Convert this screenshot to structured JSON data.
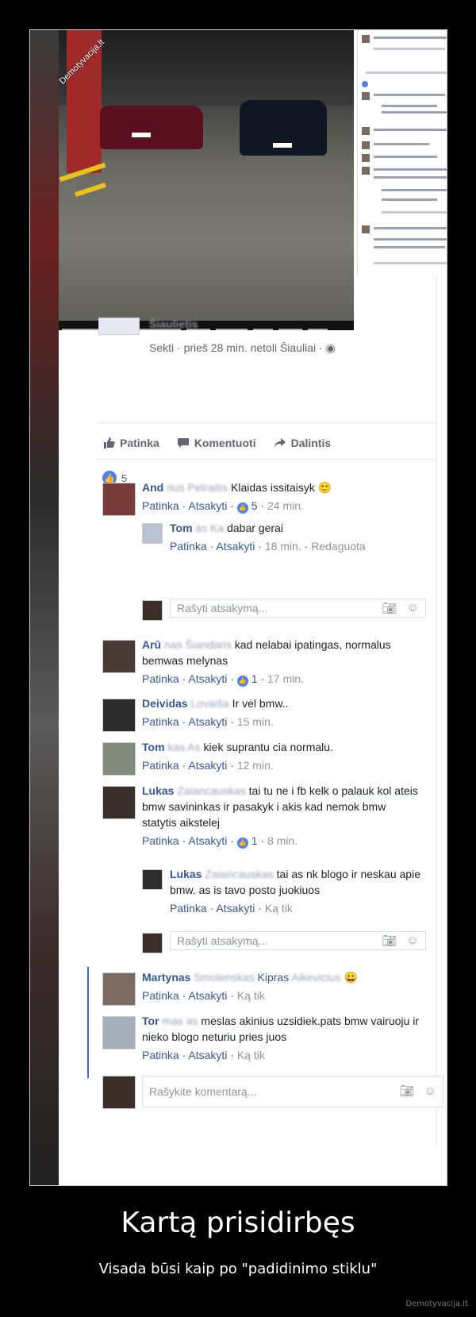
{
  "watermark": "Demotyvacija.lt",
  "post": {
    "author_blurred": "Šiaulietis",
    "meta": "Sekti · prieš 28 min. netoli Šiauliai · ",
    "actions": {
      "like": "Patinka",
      "comment": "Komentuoti",
      "share": "Dalintis"
    },
    "like_count": "5"
  },
  "comments": [
    {
      "name": "And",
      "name_blurred": "rius Petraitis",
      "text": "Klaidas issitaisyk 🙂",
      "like": "Patinka",
      "reply": "Atsakyti",
      "likes": "5",
      "time": "24 min."
    },
    {
      "name": "Tom",
      "name_blurred": "as Ka",
      "text": "dabar gerai",
      "like": "Patinka",
      "reply": "Atsakyti",
      "time": "18 min.",
      "edited": "Redaguota"
    },
    {
      "name": "Arū",
      "name_blurred": "nas Šiandaris",
      "text": "kad nelabai ipatingas, normalus bemwas melynas",
      "like": "Patinka",
      "reply": "Atsakyti",
      "likes": "1",
      "time": "17 min."
    },
    {
      "name": "Deividas",
      "name_blurred": "Lovaiša",
      "text": "Ir vėl bmw..",
      "like": "Patinka",
      "reply": "Atsakyti",
      "time": "15 min."
    },
    {
      "name": "Tom",
      "name_blurred": "kas As",
      "text": "kiek suprantu cia normalu.",
      "like": "Patinka",
      "reply": "Atsakyti",
      "time": "12 min."
    },
    {
      "name": "Lukas",
      "name_blurred": "Zaiancauskas",
      "text": "tai tu ne i fb kelk o palauk kol ateis bmw savininkas ir pasakyk i akis kad nemok bmw statytis aikstelej",
      "like": "Patinka",
      "reply": "Atsakyti",
      "likes": "1",
      "time": "8 min."
    },
    {
      "name": "Lukas",
      "name_blurred": "Zaiancauskas",
      "text": "tai as nk blogo ir neskau apie bmw. as is tavo posto juokiuos",
      "like": "Patinka",
      "reply": "Atsakyti",
      "time": "Ką tik"
    },
    {
      "name": "Martynas",
      "name_blurred": "Smolenskas",
      "text": "Kipras",
      "tag_blurred": "Aikevicius",
      "like": "Patinka",
      "reply": "Atsakyti",
      "time": "Ką tik"
    },
    {
      "name": "Tor",
      "name_blurred": "mas as",
      "text": "meslas akinius uzsidiek.pats bmw vairuoju ir nieko blogo neturiu pries juos",
      "like": "Patinka",
      "reply": "Atsakyti",
      "time": "Ką tik"
    }
  ],
  "reply_placeholder": "Rašyti atsakymą...",
  "comment_placeholder": "Rašykite komentarą...",
  "caption": {
    "title": "Kartą prisidirbęs",
    "subtitle": "Visada būsi kaip po \"padidinimo stiklu\"",
    "site": "Demotyvacija.lt"
  }
}
